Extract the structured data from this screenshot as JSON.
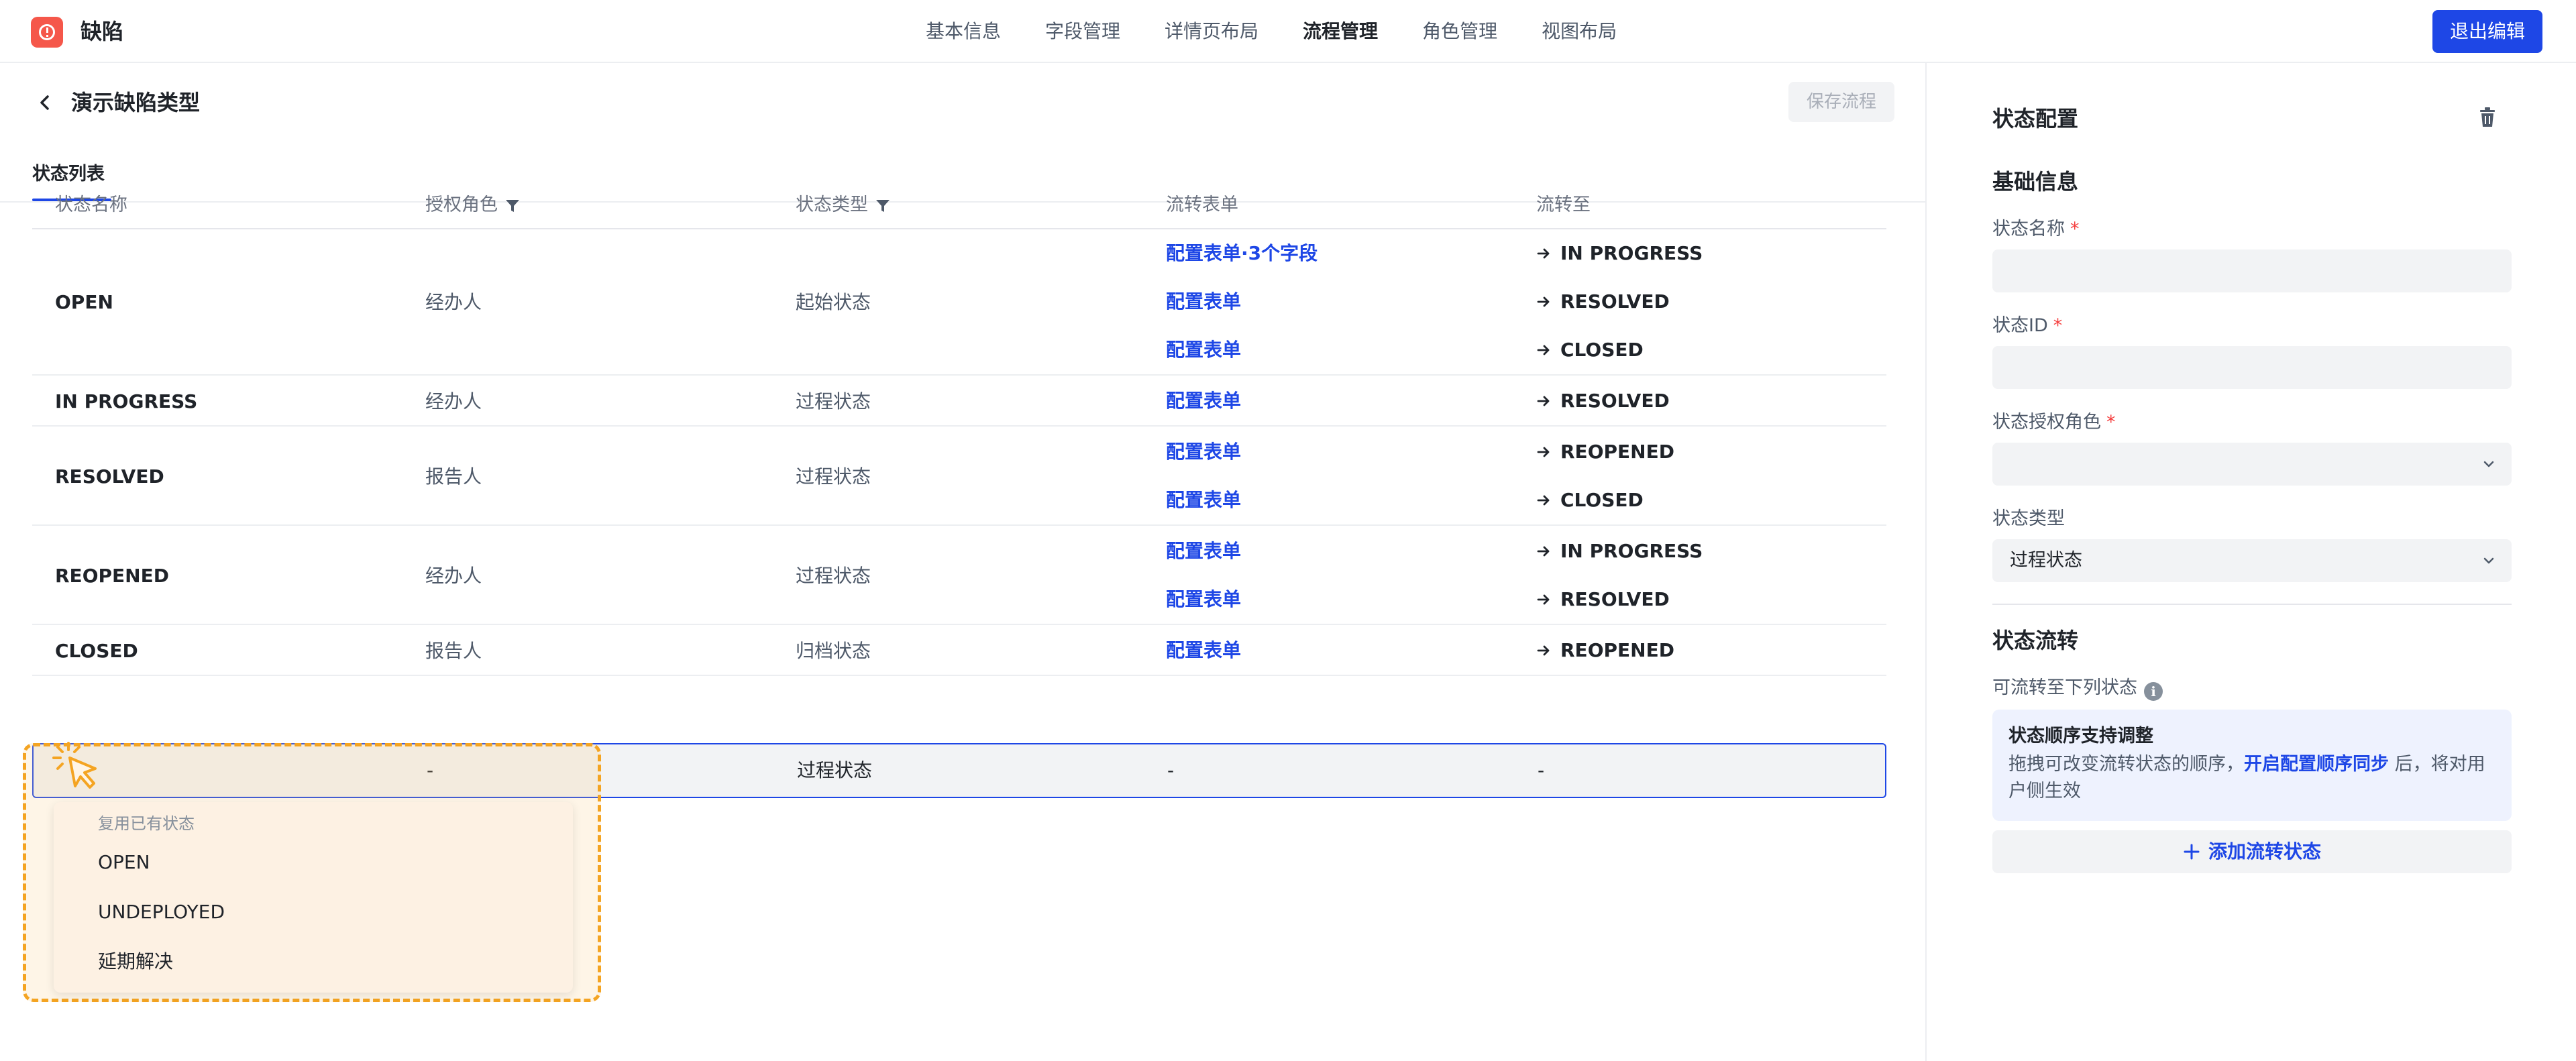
{
  "app": {
    "title": "缺陷"
  },
  "nav": {
    "items": [
      "基本信息",
      "字段管理",
      "详情页布局",
      "流程管理",
      "角色管理",
      "视图布局"
    ],
    "active_index": 3
  },
  "header": {
    "exit_label": "退出编辑"
  },
  "page": {
    "title": "演示缺陷类型",
    "save_label": "保存流程"
  },
  "tabs": {
    "status_list": "状态列表"
  },
  "table": {
    "headers": {
      "name": "状态名称",
      "role": "授权角色",
      "type": "状态类型",
      "form": "流转表单",
      "target": "流转至"
    },
    "rows": [
      {
        "name": "OPEN",
        "role": "经办人",
        "type": "起始状态",
        "transitions": [
          {
            "form": "配置表单·3个字段",
            "target": "IN PROGRESS"
          },
          {
            "form": "配置表单",
            "target": "RESOLVED"
          },
          {
            "form": "配置表单",
            "target": "CLOSED"
          }
        ]
      },
      {
        "name": "IN PROGRESS",
        "role": "经办人",
        "type": "过程状态",
        "transitions": [
          {
            "form": "配置表单",
            "target": "RESOLVED"
          }
        ]
      },
      {
        "name": "RESOLVED",
        "role": "报告人",
        "type": "过程状态",
        "transitions": [
          {
            "form": "配置表单",
            "target": "REOPENED"
          },
          {
            "form": "配置表单",
            "target": "CLOSED"
          }
        ]
      },
      {
        "name": "REOPENED",
        "role": "经办人",
        "type": "过程状态",
        "transitions": [
          {
            "form": "配置表单",
            "target": "IN PROGRESS"
          },
          {
            "form": "配置表单",
            "target": "RESOLVED"
          }
        ]
      },
      {
        "name": "CLOSED",
        "role": "报告人",
        "type": "归档状态",
        "transitions": [
          {
            "form": "配置表单",
            "target": "REOPENED"
          }
        ]
      }
    ],
    "new_row": {
      "name": "",
      "role": "-",
      "type": "过程状态",
      "form": "-",
      "target": "-"
    }
  },
  "dropdown": {
    "label": "复用已有状态",
    "items": [
      "OPEN",
      "UNDEPLOYED",
      "延期解决"
    ]
  },
  "config": {
    "title": "状态配置",
    "basic_section": "基础信息",
    "name_label": "状态名称",
    "id_label": "状态ID",
    "role_label": "状态授权角色",
    "required_mark": "*",
    "type_label": "状态类型",
    "type_value": "过程状态",
    "flow_section": "状态流转",
    "flow_label": "可流转至下列状态",
    "info_glyph": "i",
    "tip": {
      "title": "状态顺序支持调整",
      "text_before": "拖拽可改变流转状态的顺序，",
      "link": "开启配置顺序同步",
      "text_after": " 后，将对用户侧生效"
    },
    "add_label": "添加流转状态"
  },
  "colors": {
    "accent": "#1e47e6",
    "logo": "#f5574a",
    "highlight": "#f4a422",
    "required": "#f53f3f"
  },
  "icons": [
    "defect-logo-icon",
    "back-arrow-icon",
    "filter-icon",
    "arrow-right-icon",
    "cursor-click-icon",
    "trash-icon",
    "chevron-down-icon",
    "info-icon",
    "plus-icon"
  ]
}
